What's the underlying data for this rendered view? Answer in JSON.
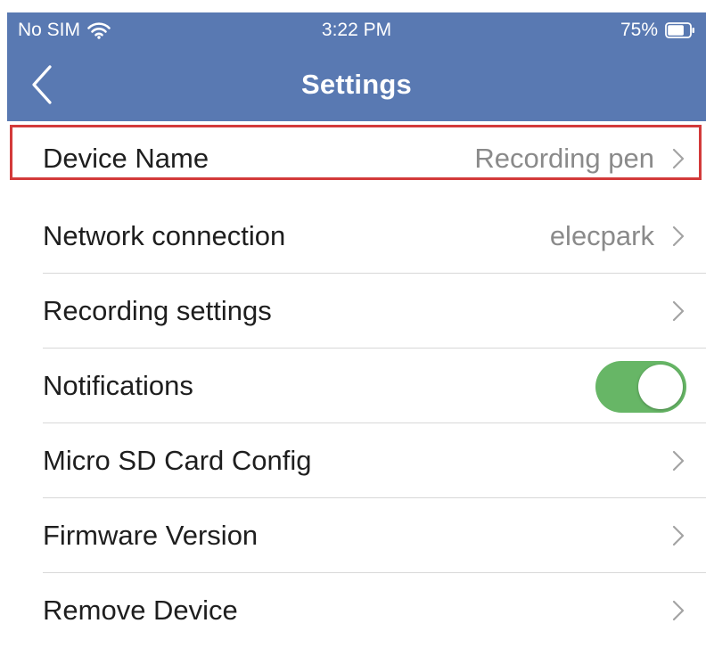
{
  "status_bar": {
    "carrier": "No SIM",
    "time": "3:22 PM",
    "battery": "75%",
    "battery_fraction": 0.75
  },
  "nav": {
    "title": "Settings",
    "back_icon": "chevron-left-icon"
  },
  "colors": {
    "header_bg": "#5979b2",
    "header_text": "#ffffff",
    "toggle_on": "#67b666",
    "highlight_border": "#d33a3a",
    "value_text": "#8a8a8a"
  },
  "settings": {
    "items": [
      {
        "label": "Device Name",
        "value": "Recording pen",
        "control": "chevron"
      },
      {
        "label": "Network connection",
        "value": "elecpark",
        "control": "chevron"
      },
      {
        "label": "Recording settings",
        "value": "",
        "control": "chevron"
      },
      {
        "label": "Notifications",
        "value": "",
        "control": "toggle",
        "toggle_on": true
      },
      {
        "label": "Micro SD Card Config",
        "value": "",
        "control": "chevron"
      },
      {
        "label": "Firmware Version",
        "value": "",
        "control": "chevron"
      },
      {
        "label": "Remove Device",
        "value": "",
        "control": "chevron"
      }
    ]
  }
}
